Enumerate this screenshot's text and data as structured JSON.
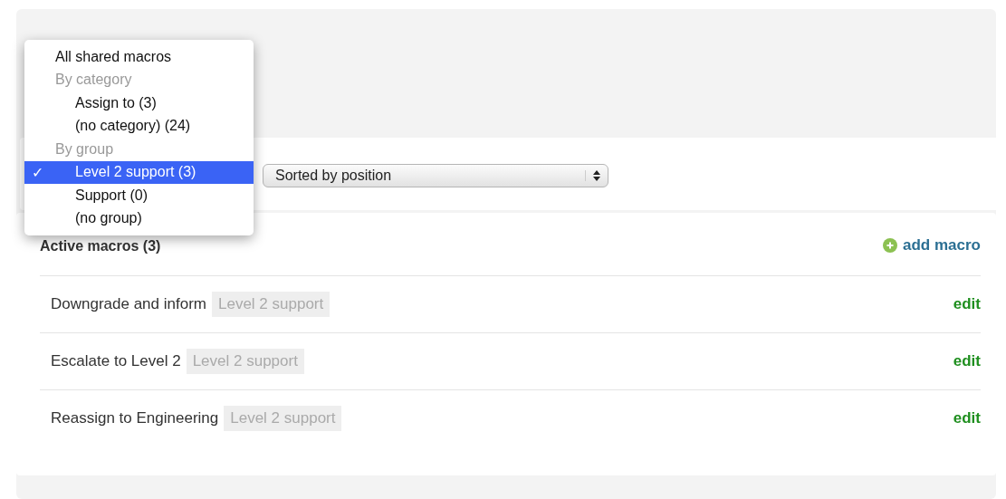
{
  "filter_menu": {
    "items": [
      {
        "kind": "option",
        "label": "All shared macros",
        "selected": false
      },
      {
        "kind": "group",
        "label": "By category",
        "children": [
          {
            "label": "Assign to (3)",
            "selected": false
          },
          {
            "label": "(no category) (24)",
            "selected": false
          }
        ]
      },
      {
        "kind": "group",
        "label": "By group",
        "children": [
          {
            "label": "Level 2 support (3)",
            "selected": true,
            "check": "✓"
          },
          {
            "label": "Support (0)",
            "selected": false
          },
          {
            "label": "(no group)",
            "selected": false
          }
        ]
      }
    ]
  },
  "sort_select": {
    "value": "Sorted by position"
  },
  "macros": {
    "title": "Active macros (3)",
    "add_link": "add macro",
    "rows": [
      {
        "name": "Downgrade and inform",
        "tag": "Level 2 support",
        "action": "edit"
      },
      {
        "name": "Escalate to Level 2",
        "tag": "Level 2 support",
        "action": "edit"
      },
      {
        "name": "Reassign to Engineering",
        "tag": "Level 2 support",
        "action": "edit"
      }
    ]
  }
}
